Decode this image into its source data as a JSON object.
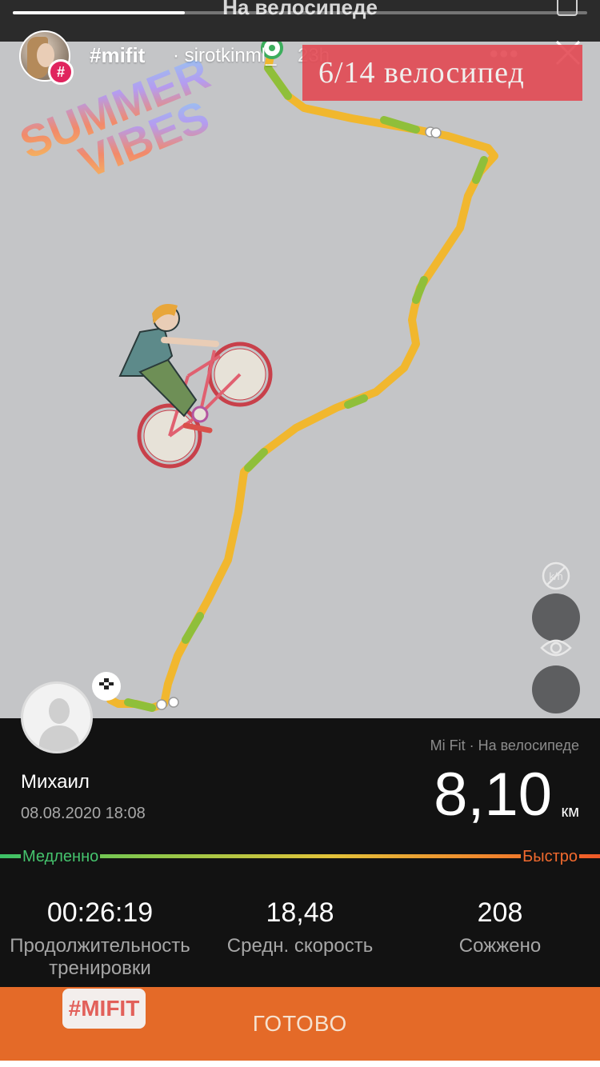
{
  "topbar": {
    "title": "На велосипеде",
    "story_progress": 0.3
  },
  "story": {
    "tag": "#mifit",
    "separator": "·",
    "username": "sirotkinml_",
    "time": "23h",
    "more": "•••",
    "badge": "#"
  },
  "stickers": {
    "title_text": "6/14 велосипед",
    "vibes_line1": "SUMMER",
    "vibes_line2": "VIBES",
    "hashtag": "#MIFIT"
  },
  "workout": {
    "user_name": "Михаил",
    "date": "08.08.2020 18:08",
    "app_label": "Mi Fit · На велосипеде",
    "distance": "8,10",
    "distance_unit": "км",
    "speed_slow": "Медленно",
    "speed_fast": "Быстро",
    "stats": [
      {
        "value": "00:26:19",
        "label": "Продолжительность тренировки"
      },
      {
        "value": "18,48",
        "label": "Средн. скорость"
      },
      {
        "value": "208",
        "label": "Сожжено"
      }
    ],
    "done_label": "ГОТОВО"
  },
  "icons": {
    "unit_toggle": "km-unit-off-icon",
    "visibility": "eye-icon",
    "start": "start-marker-icon",
    "finish": "checkered-flag-icon"
  },
  "colors": {
    "route_main": "#f1b72e",
    "route_fast": "#8fbf3a",
    "accent": "#e46a28",
    "sticker_red": "#e24650"
  }
}
